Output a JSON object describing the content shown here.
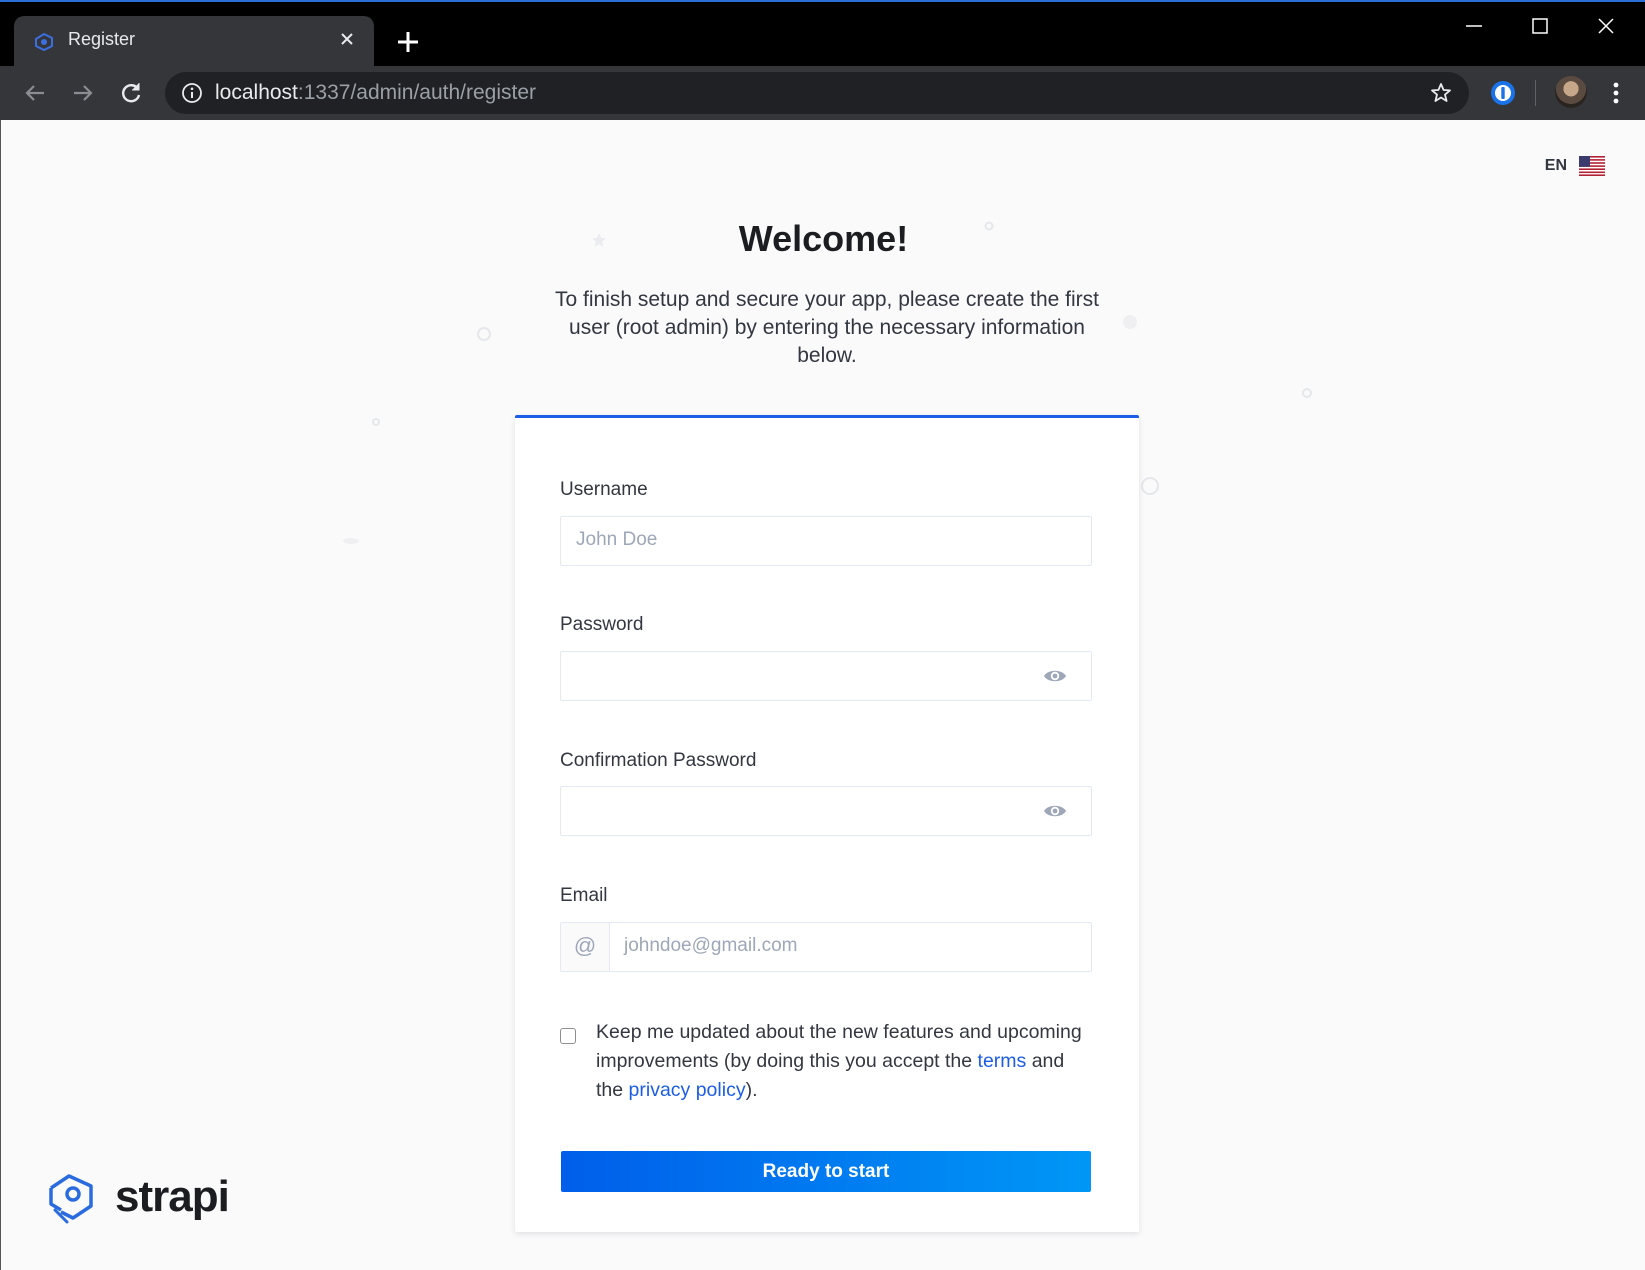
{
  "browser": {
    "tab_title": "Register",
    "url_host": "localhost",
    "url_path": ":1337/admin/auth/register"
  },
  "page": {
    "language": "EN",
    "welcome": "Welcome!",
    "subtitle": "To finish setup and secure your app, please create the first user (root admin) by entering the necessary information below.",
    "form": {
      "username_label": "Username",
      "username_placeholder": "John Doe",
      "password_label": "Password",
      "confirm_password_label": "Confirmation Password",
      "email_label": "Email",
      "email_prefix": "@",
      "email_placeholder": "johndoe@gmail.com",
      "consent_text_1": "Keep me updated about the new features and upcoming improvements (by doing this you accept the ",
      "terms_link": "terms",
      "consent_text_2": " and the ",
      "privacy_link": "privacy policy",
      "consent_text_3": ").",
      "submit_label": "Ready to start"
    },
    "brand": "strapi"
  },
  "colors": {
    "accent": "#1c5de7",
    "button_gradient_start": "#005eea",
    "button_gradient_end": "#0097f6",
    "page_background": "#fafafb"
  }
}
